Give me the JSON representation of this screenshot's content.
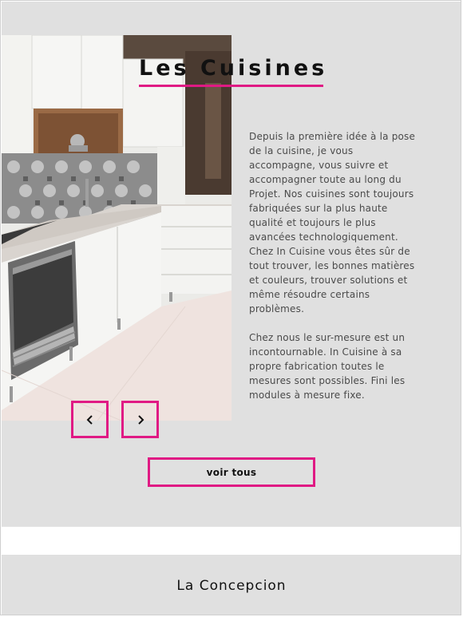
{
  "cuisines": {
    "title": "Les Cuisines",
    "paragraphs": [
      "Depuis la première idée à la pose de la cuisine, je vous accompagne, vous suivre et accompagner toute au long du Projet. Nos cuisines sont toujours fabriquées sur la plus haute qualité et toujours le plus avancées technologiquement. Chez In Cuisine vous êtes sûr de tout trouver, les bonnes matières et couleurs, trouver solutions et même résoudre certains problèmes.",
      "Chez nous le sur-mesure est un incontournable. In Cuisine à sa propre fabrication toutes le mesures sont possibles. Fini les modules à mesure fixe."
    ],
    "nav": {
      "prev_icon": "chevron-left-icon",
      "next_icon": "chevron-right-icon"
    },
    "voir_tous_label": "voir tous"
  },
  "concepcion": {
    "title": "La Concepcion"
  },
  "colors": {
    "accent": "#e01a84",
    "section_bg": "#e0e0e0",
    "text": "#4a4a4a"
  }
}
